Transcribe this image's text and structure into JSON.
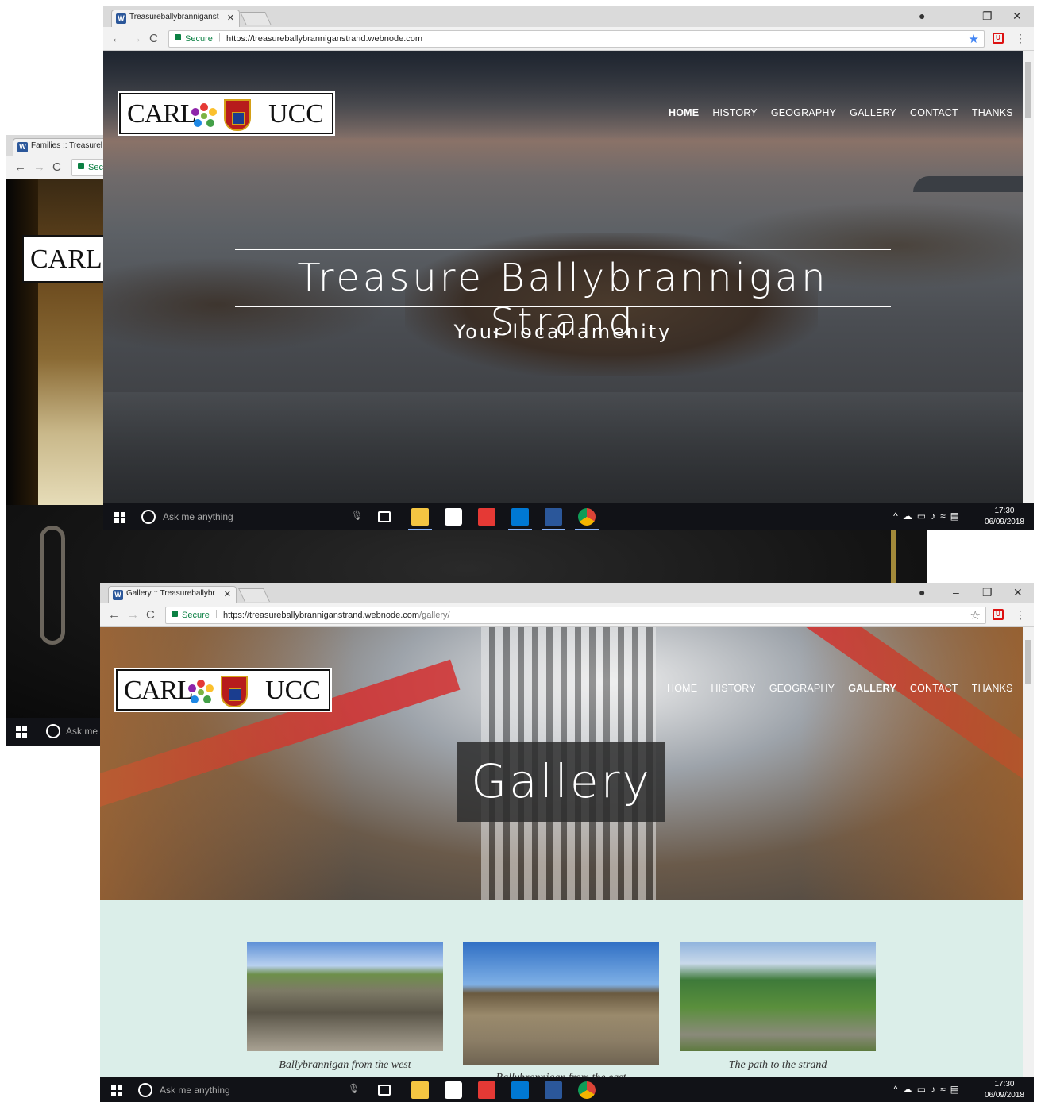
{
  "back_window": {
    "tab_title": "Families :: Treasurel",
    "secure_label": "Sec",
    "logo_text": "CARL",
    "taskbar_search": "Ask me"
  },
  "window_top": {
    "tab_title": "Treasureballybranniganst",
    "secure_label": "Secure",
    "url_host": "https://treasureballybranniganstrand.webnode.com",
    "url_path": "",
    "logo": {
      "left": "CARL",
      "right": "UCC"
    },
    "nav": [
      "HOME",
      "HISTORY",
      "GEOGRAPHY",
      "GALLERY",
      "CONTACT",
      "THANKS"
    ],
    "active_nav": "HOME",
    "hero_title": "Treasure Ballybrannigan Strand",
    "hero_subtitle": "Your local amenity",
    "taskbar": {
      "search": "Ask me anything",
      "time": "17:30",
      "date": "06/09/2018"
    }
  },
  "window_bottom": {
    "tab_title": "Gallery :: Treasureballybr",
    "secure_label": "Secure",
    "url_host": "https://treasureballybranniganstrand.webnode.com",
    "url_path": "/gallery/",
    "logo": {
      "left": "CARL",
      "right": "UCC"
    },
    "nav": [
      "HOME",
      "HISTORY",
      "GEOGRAPHY",
      "GALLERY",
      "CONTACT",
      "THANKS"
    ],
    "active_nav": "GALLERY",
    "hero_title": "Gallery",
    "gallery": [
      {
        "caption": "Ballybrannigan from the west"
      },
      {
        "caption": "Ballybrannigan from the east"
      },
      {
        "caption": "The path to the strand"
      }
    ],
    "taskbar": {
      "search": "Ask me anything",
      "time": "17:30",
      "date": "06/09/2018"
    }
  },
  "icons": {
    "back": "←",
    "forward": "→",
    "reload": "C",
    "close": "✕",
    "minimize": "–",
    "maximize": "❐",
    "account": "●",
    "star": "★",
    "star_outline": "☆",
    "menu": "⋮"
  },
  "colors": {
    "accent_secure": "#0b8043",
    "chrome_bar": "#f2f2f2",
    "taskbar": "#111217",
    "gallery_bg": "#dbeee9"
  }
}
